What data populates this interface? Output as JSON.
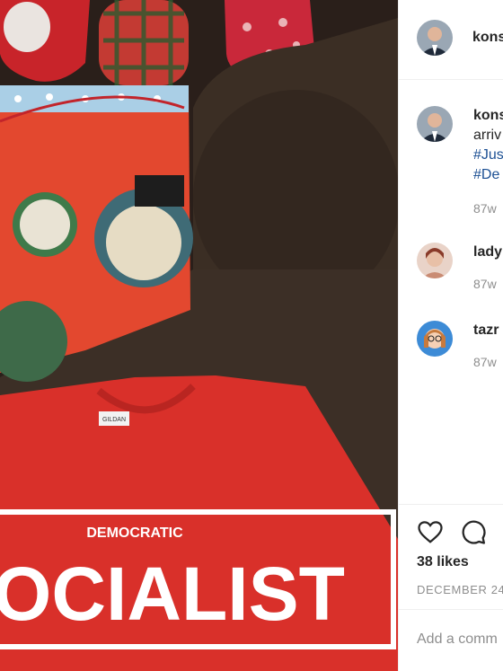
{
  "post": {
    "author": "kons",
    "caption_author": "kons",
    "caption_lines": [
      "arriv",
      "#Jus",
      "#De"
    ],
    "caption_age": "87w",
    "likes": "38 likes",
    "date": "DECEMBER 24",
    "add_comment_placeholder": "Add a comm"
  },
  "comments": [
    {
      "user": "lady",
      "age": "87w"
    },
    {
      "user": "tazr",
      "age": "87w"
    }
  ],
  "photo": {
    "shirt_word_1": "DEMOCRATIC",
    "shirt_word_2": "OCIALIST",
    "shirt_tag": "GILDAN"
  },
  "colors": {
    "hashtag": "#1b4f93",
    "shirt": "#d9302a"
  }
}
